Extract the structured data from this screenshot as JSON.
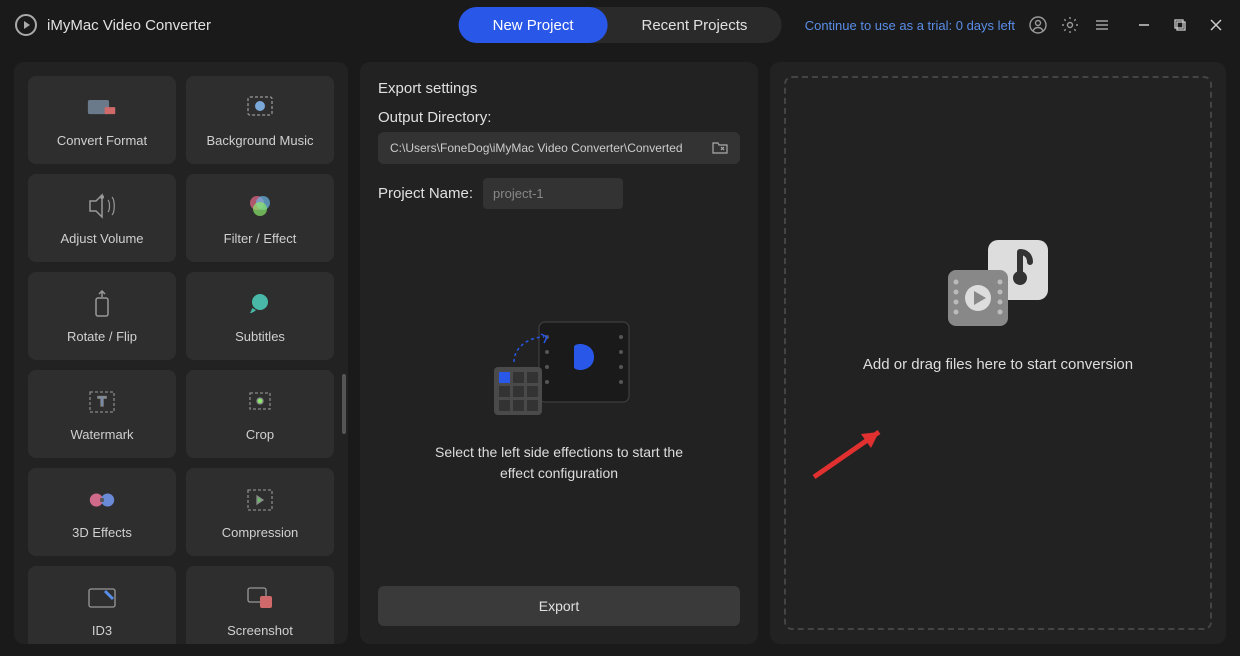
{
  "app": {
    "title": "iMyMac Video Converter",
    "trial_text": "Continue to use as a trial: 0 days left"
  },
  "nav": {
    "new_project": "New Project",
    "recent_projects": "Recent Projects"
  },
  "sidebar": {
    "tools": [
      {
        "name": "convert-format",
        "label": "Convert Format"
      },
      {
        "name": "background-music",
        "label": "Background Music"
      },
      {
        "name": "adjust-volume",
        "label": "Adjust Volume"
      },
      {
        "name": "filter-effect",
        "label": "Filter / Effect"
      },
      {
        "name": "rotate-flip",
        "label": "Rotate / Flip"
      },
      {
        "name": "subtitles",
        "label": "Subtitles"
      },
      {
        "name": "watermark",
        "label": "Watermark"
      },
      {
        "name": "crop",
        "label": "Crop"
      },
      {
        "name": "3d-effects",
        "label": "3D Effects"
      },
      {
        "name": "compression",
        "label": "Compression"
      },
      {
        "name": "id3",
        "label": "ID3"
      },
      {
        "name": "screenshot",
        "label": "Screenshot"
      }
    ]
  },
  "center": {
    "export_settings": "Export settings",
    "output_directory_label": "Output Directory:",
    "output_path": "C:\\Users\\FoneDog\\iMyMac Video Converter\\Converted",
    "project_name_label": "Project Name:",
    "project_name_value": "project-1",
    "hint": "Select the left side effections to start the effect configuration",
    "export_button": "Export"
  },
  "right": {
    "drop_text": "Add or drag files here to start conversion"
  }
}
